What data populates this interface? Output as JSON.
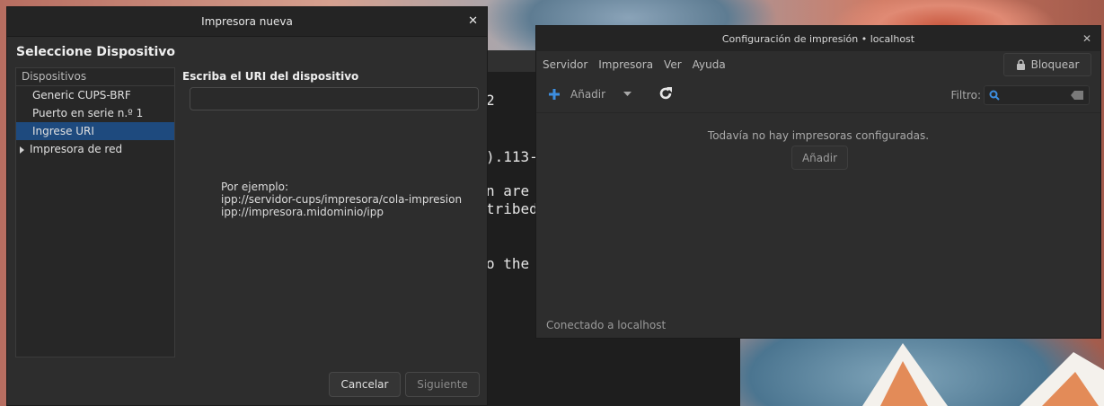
{
  "terminal": {
    "lines": [
      "2",
      ").113-",
      "n are",
      "tribed",
      "o the"
    ]
  },
  "new_printer_dialog": {
    "title": "Impresora nueva",
    "heading": "Seleccione Dispositivo",
    "devices_header": "Dispositivos",
    "devices": [
      {
        "label": "Generic CUPS-BRF"
      },
      {
        "label": "Puerto en serie n.º 1"
      },
      {
        "label": "Ingrese URI",
        "selected": true
      },
      {
        "label": "Impresora de red",
        "expandable": true
      }
    ],
    "uri_label": "Escriba el URI del dispositivo",
    "uri_value": "",
    "example_title": "Por ejemplo:",
    "example_1": "ipp://servidor-cups/impresora/cola-impresion",
    "example_2": "ipp://impresora.midominio/ipp",
    "cancel_label": "Cancelar",
    "next_label": "Siguiente"
  },
  "print_settings": {
    "title": "Configuración de impresión • localhost",
    "menu": [
      "Servidor",
      "Impresora",
      "Ver",
      "Ayuda"
    ],
    "lock_label": "Bloquear",
    "add_label": "Añadir",
    "filter_label": "Filtro:",
    "filter_value": "",
    "empty_message": "Todavía no hay impresoras configuradas.",
    "empty_add_label": "Añadir",
    "status": "Conectado a localhost"
  },
  "colors": {
    "selection": "#1e4a7e",
    "add_icon": "#3d8ee0"
  }
}
